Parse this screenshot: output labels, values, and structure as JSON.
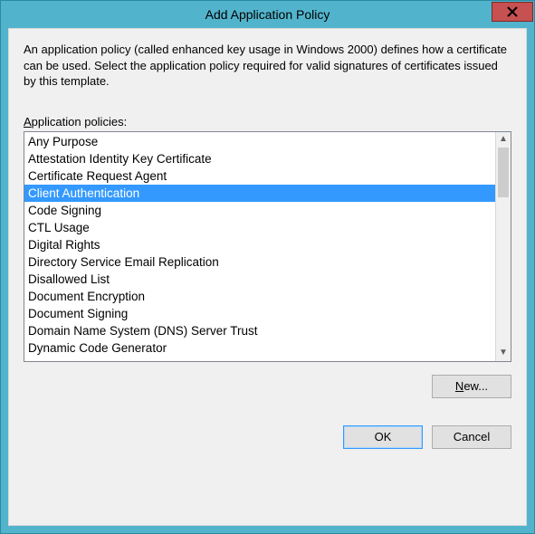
{
  "window": {
    "title": "Add Application Policy"
  },
  "description": "An application policy (called enhanced key usage in Windows 2000) defines how a certificate can be used. Select the application policy required for valid signatures of certificates issued by this template.",
  "label": {
    "prefix": "A",
    "rest": "pplication policies:"
  },
  "policies": [
    {
      "label": "Any Purpose",
      "selected": false
    },
    {
      "label": "Attestation Identity Key Certificate",
      "selected": false
    },
    {
      "label": "Certificate Request Agent",
      "selected": false
    },
    {
      "label": "Client Authentication",
      "selected": true
    },
    {
      "label": "Code Signing",
      "selected": false
    },
    {
      "label": "CTL Usage",
      "selected": false
    },
    {
      "label": "Digital Rights",
      "selected": false
    },
    {
      "label": "Directory Service Email Replication",
      "selected": false
    },
    {
      "label": "Disallowed List",
      "selected": false
    },
    {
      "label": "Document Encryption",
      "selected": false
    },
    {
      "label": "Document Signing",
      "selected": false
    },
    {
      "label": "Domain Name System (DNS) Server Trust",
      "selected": false
    },
    {
      "label": "Dynamic Code Generator",
      "selected": false
    }
  ],
  "buttons": {
    "new_prefix": "N",
    "new_rest": "ew...",
    "ok": "OK",
    "cancel": "Cancel"
  }
}
